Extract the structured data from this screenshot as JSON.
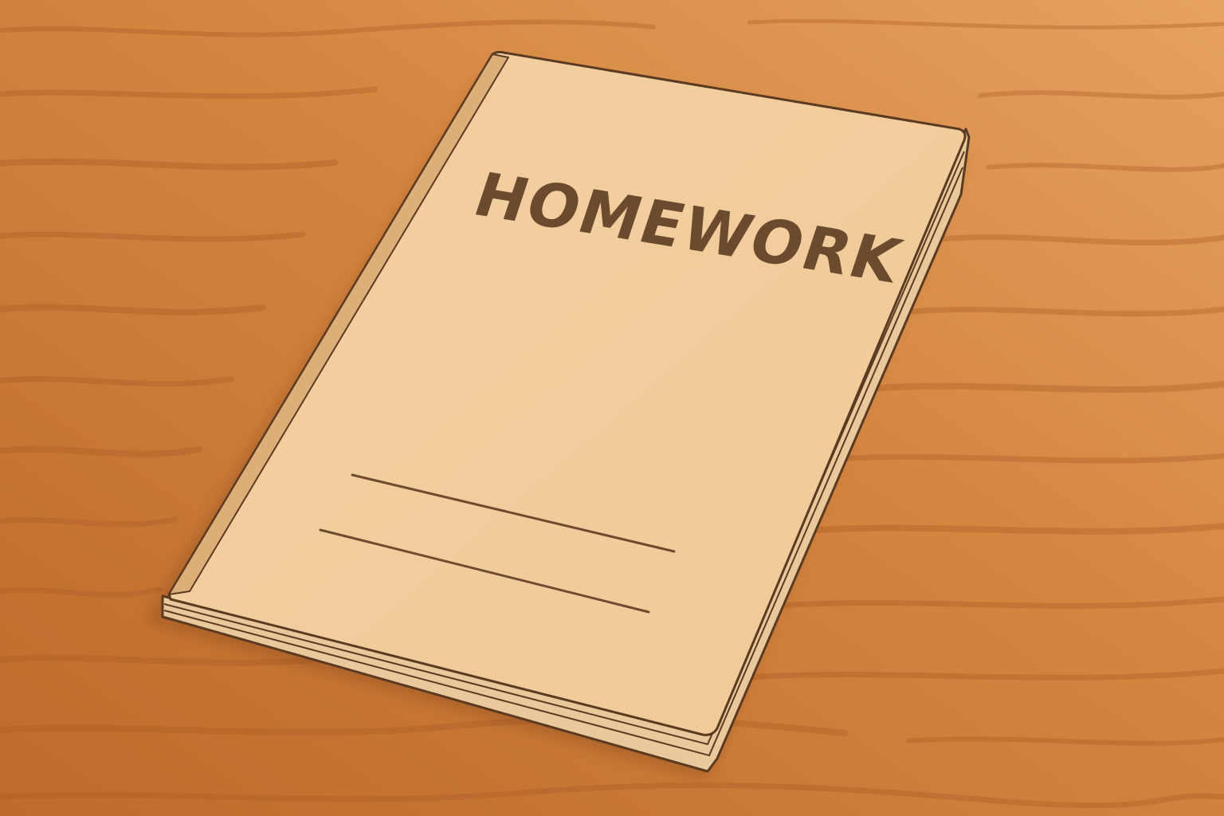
{
  "scene": {
    "subject": "notebook",
    "cover": {
      "title": "HOMEWORK",
      "write_lines": 2
    },
    "colors": {
      "table_light": "#e39b58",
      "table_mid": "#d07f3b",
      "table_dark": "#b9652a",
      "grain": "#a85a24",
      "cover": "#f3cf9f",
      "cover_shade": "#ecc48f",
      "spine": "#d9ad78",
      "pages": "#f0d6b0",
      "outline": "#5b3a22",
      "title_ink": "#6b4a2e",
      "line_ink": "#6e4b30",
      "shadow": "#8a4a1c"
    }
  }
}
